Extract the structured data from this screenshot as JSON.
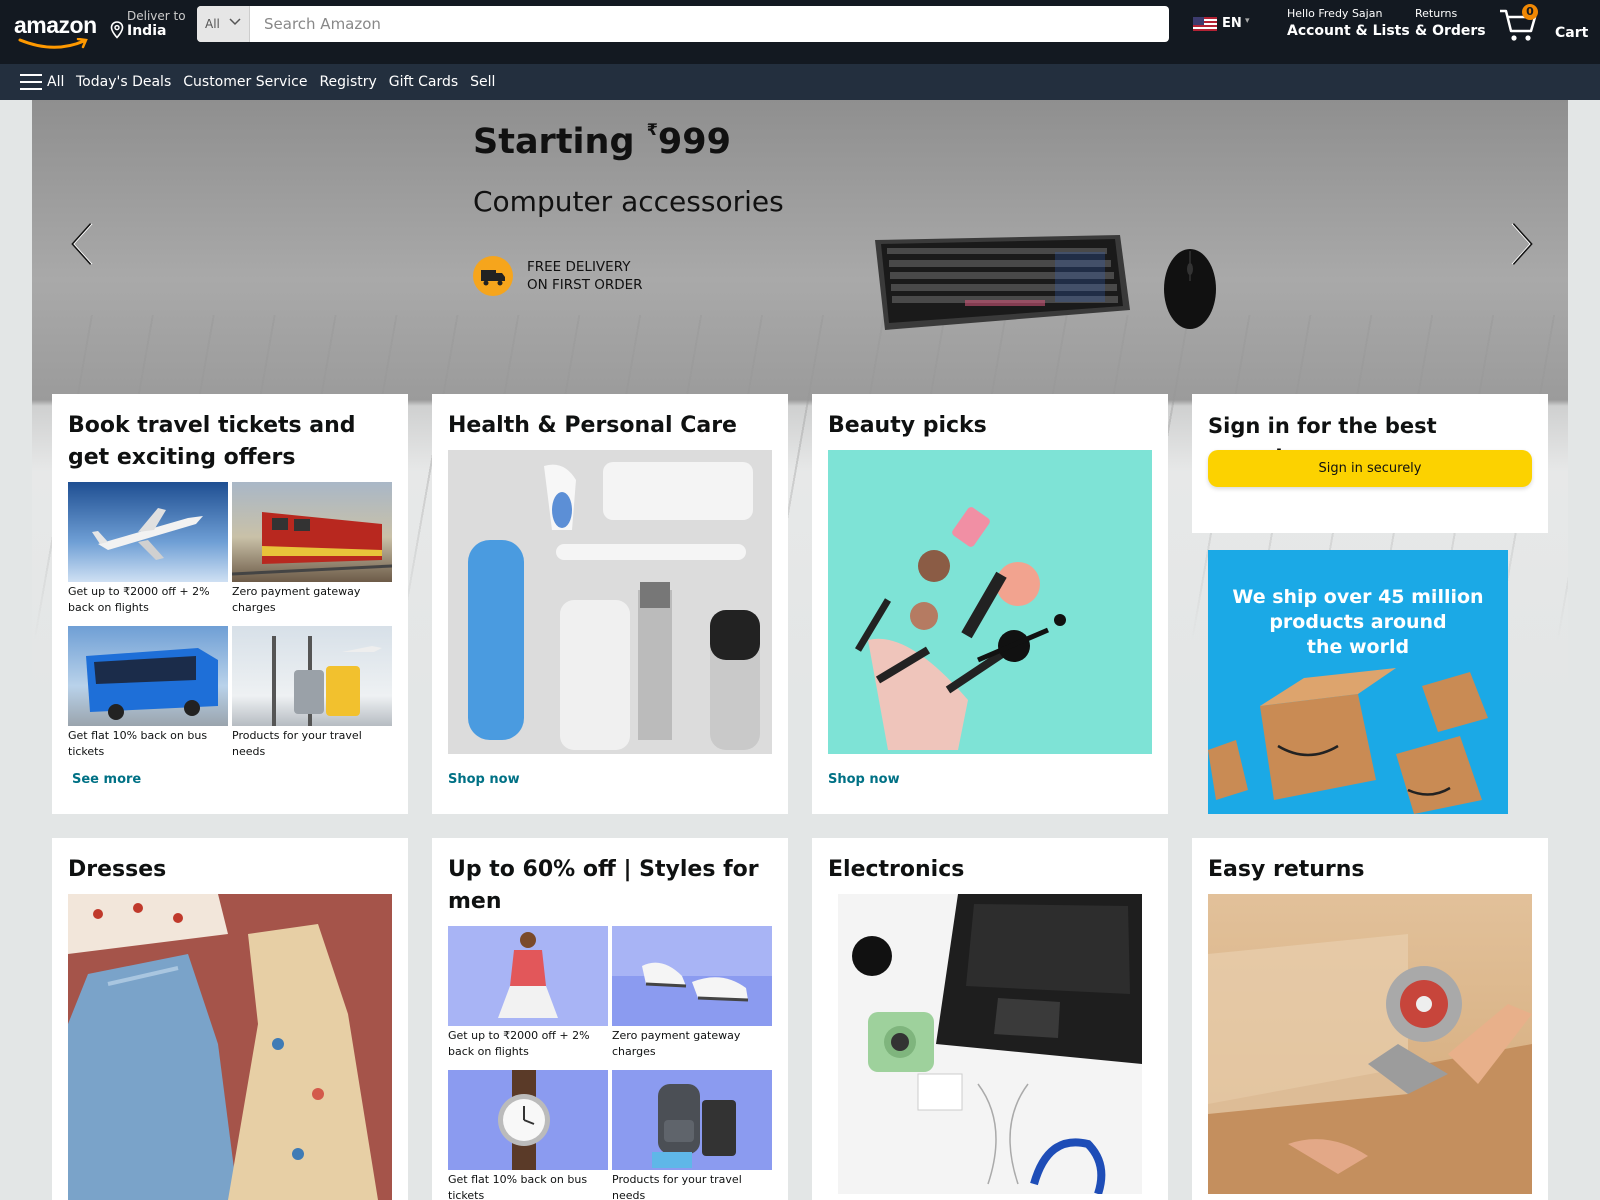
{
  "header": {
    "logo_text": "amazon",
    "deliver_line1": "Deliver to",
    "deliver_line2": "India",
    "search_category": "All",
    "search_placeholder": "Search Amazon",
    "language_code": "EN",
    "account_line1": "Hello Fredy Sajan",
    "account_line2": "Account & Lists",
    "orders_line1": "Returns",
    "orders_line2": "& Orders",
    "cart_count": "0",
    "cart_label": "Cart"
  },
  "subnav": {
    "all_label": "All",
    "links": [
      "Today's Deals",
      "Customer Service",
      "Registry",
      "Gift Cards",
      "Sell"
    ]
  },
  "hero": {
    "headline_prefix": "Starting",
    "currency": "₹",
    "price": "999",
    "subtitle": "Computer accessories",
    "delivery_line1": "FREE DELIVERY",
    "delivery_line2": "ON FIRST ORDER"
  },
  "cards": {
    "travel": {
      "title": "Book travel tickets and get exciting offers",
      "tiles": [
        {
          "caption": "Get up to ₹2000 off + 2% back on flights",
          "icon": "airplane"
        },
        {
          "caption": "Zero payment gateway charges",
          "icon": "train"
        },
        {
          "caption": "Get flat 10% back on bus tickets",
          "icon": "bus"
        },
        {
          "caption": "Products for your travel needs",
          "icon": "luggage"
        }
      ],
      "link": "See more"
    },
    "health": {
      "title": "Health & Personal Care",
      "link": "Shop now"
    },
    "beauty": {
      "title": "Beauty picks",
      "link": "Shop now"
    },
    "signin": {
      "title": "Sign in for the best experience",
      "button": "Sign in securely"
    },
    "ad": {
      "lines": [
        "We ship over 45 million",
        "products around",
        "the world"
      ]
    },
    "dresses": {
      "title": "Dresses"
    },
    "men": {
      "title": "Up to 60% off | Styles for men",
      "tiles": [
        {
          "caption": "Get up to ₹2000 off + 2% back on flights",
          "icon": "shirt-model"
        },
        {
          "caption": "Zero payment gateway charges",
          "icon": "sneakers"
        },
        {
          "caption": "Get flat 10% back on bus tickets",
          "icon": "watch"
        },
        {
          "caption": "Products for your travel needs",
          "icon": "backpack"
        }
      ]
    },
    "electronics": {
      "title": "Electronics"
    },
    "returns": {
      "title": "Easy returns"
    }
  },
  "colors": {
    "nav_dark": "#131921",
    "nav_sub": "#232f3e",
    "search_button": "#febd69",
    "link": "#007185",
    "signin_button": "#fcd200",
    "ad_background": "#1ba9e6"
  }
}
